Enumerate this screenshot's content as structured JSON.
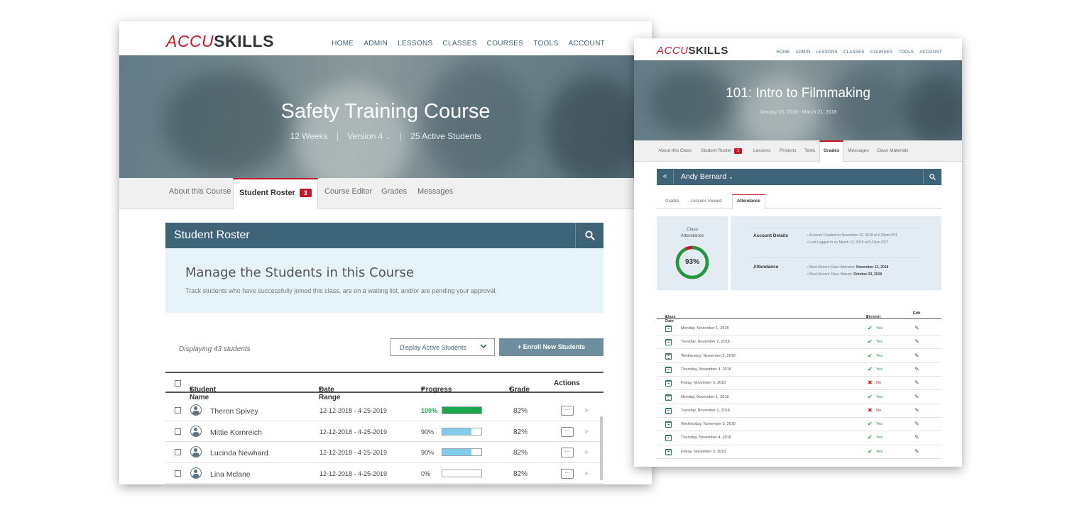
{
  "left": {
    "logo": {
      "accent": "ACCU",
      "rest": "SKILLS"
    },
    "nav": [
      "HOME",
      "ADMIN",
      "LESSONS",
      "CLASSES",
      "COURSES",
      "TOOLS",
      "ACCOUNT"
    ],
    "hero": {
      "title": "Safety Training Course",
      "weeks": "12 Weeks",
      "version": "Version 4",
      "students": "25 Active Students"
    },
    "tabs": {
      "about": "About this Course",
      "roster": "Student Roster",
      "roster_badge": "3",
      "editor": "Course Editor",
      "grades": "Grades",
      "messages": "Messages"
    },
    "panel_title": "Student Roster",
    "info": {
      "heading": "Manage the Students in this Course",
      "text": "Track students who have successfully joined this class, are on a waiting list, and/or are pending your approval."
    },
    "displaying": "Displaying 43 students",
    "filter": {
      "selected": "Display Active Students"
    },
    "enroll_label": "+ Enroll New Students",
    "columns": {
      "name": "Student Name",
      "date": "Date Range",
      "progress": "Progress",
      "grade": "Grade",
      "actions": "Actions"
    },
    "students": [
      {
        "name": "Theron Spivey",
        "range": "12-12-2018 - 4-25-2019",
        "progress_label": "100%",
        "progress": 1.0,
        "grade": "82%"
      },
      {
        "name": "Mittie Kornreich",
        "range": "12-12-2018 - 4-25-2019",
        "progress_label": "90%",
        "progress": 0.75,
        "grade": "82%"
      },
      {
        "name": "Lucinda Newhard",
        "range": "12-12-2018 - 4-25-2019",
        "progress_label": "90%",
        "progress": 0.75,
        "grade": "82%"
      },
      {
        "name": "Lina Mclane",
        "range": "12-12-2018 - 4-25-2019",
        "progress_label": "0%",
        "progress": 0.0,
        "grade": "82%"
      }
    ],
    "colors": {
      "accent": "#c4182a",
      "primary": "#3f6478",
      "progress_full": "#1aa64a",
      "progress_partial": "#7fcdea"
    }
  },
  "right": {
    "logo": {
      "accent": "ACCU",
      "rest": "SKILLS"
    },
    "nav": [
      "HOME",
      "ADMIN",
      "LESSONS",
      "CLASSES",
      "COURSES",
      "TOOLS",
      "ACCOUNT"
    ],
    "hero": {
      "title": "101: Intro to Filmmaking",
      "dates": "January 15, 2018 - March 21, 2018"
    },
    "tabs": {
      "about": "About this Class",
      "roster": "Student Roster",
      "roster_badge": "3",
      "lessons": "Lessons",
      "projects": "Projects",
      "tests": "Tests",
      "grades": "Grades",
      "messages": "Messages",
      "materials": "Class Materials"
    },
    "student_name": "Andy Bernard",
    "subtabs": {
      "grades": "Grades",
      "lessons_viewed": "Lessons Viewed",
      "attendance": "Attendance"
    },
    "attendance_card": {
      "label_line1": "Class",
      "label_line2": "Attendance",
      "percent_label": "93%",
      "percent": 0.93
    },
    "account": {
      "heading": "Account Details",
      "line1": "• Account Created on November 12, 2018 at 6:20pm PST",
      "line2": "• Last Logged In on March 12, 2019 at 6:47pm PST"
    },
    "attendance": {
      "heading": "Attendance",
      "line1_label": "• Most Recent Class Attended:",
      "line1_value": "November 13, 2018",
      "line2_label": "• Most Recent Class Missed:",
      "line2_value": "October 23, 2018"
    },
    "columns": {
      "date": "Class Date",
      "present": "Present",
      "edit": "Edit"
    },
    "rows": [
      {
        "date": "Monday, November 1, 2018",
        "present": true,
        "status": "Yes"
      },
      {
        "date": "Tuesday, November 2, 2018",
        "present": true,
        "status": "Yes"
      },
      {
        "date": "Wednesday, November 3, 2018",
        "present": true,
        "status": "Yes"
      },
      {
        "date": "Thursday, November 4, 2018",
        "present": true,
        "status": "Yes"
      },
      {
        "date": "Friday, November 5, 2018",
        "present": false,
        "status": "No"
      },
      {
        "date": "Monday, November 1, 2018",
        "present": true,
        "status": "Yes"
      },
      {
        "date": "Tuesday, November 2, 2018",
        "present": false,
        "status": "No"
      },
      {
        "date": "Wednesday, November 3, 2018",
        "present": true,
        "status": "Yes"
      },
      {
        "date": "Thursday, November 4, 2018",
        "present": true,
        "status": "Yes"
      },
      {
        "date": "Friday, November 5, 2018",
        "present": true,
        "status": "Yes"
      }
    ],
    "colors": {
      "present": "#1f9a3c",
      "absent": "#d21f1f",
      "ring": "#1f9a3c",
      "ring_missing": "#c4182a"
    }
  }
}
